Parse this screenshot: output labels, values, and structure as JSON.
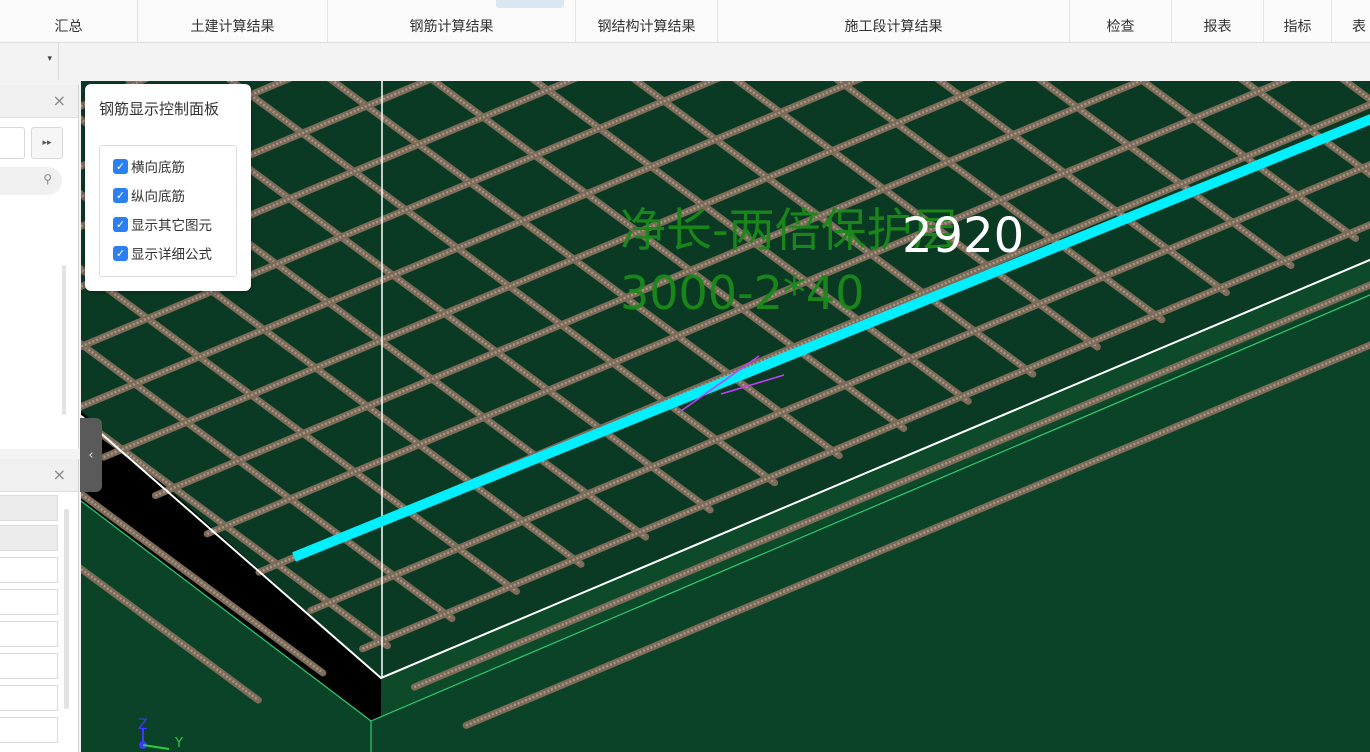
{
  "ribbon": {
    "tabs": [
      {
        "label": "汇总"
      },
      {
        "label": "土建计算结果"
      },
      {
        "label": "钢筋计算结果"
      },
      {
        "label": "钢结构计算结果"
      },
      {
        "label": "施工段计算结果"
      },
      {
        "label": "检查"
      },
      {
        "label": "报表"
      },
      {
        "label": "指标"
      },
      {
        "label": "表"
      }
    ]
  },
  "toolbar": {
    "dropdown_arrow": "▾"
  },
  "left_panel_top": {
    "close_glyph": "×",
    "expand_glyph": "▸▸",
    "search_icon": "search-icon"
  },
  "left_panel_bottom": {
    "close_glyph": "×"
  },
  "collapse_handle": {
    "glyph": "‹"
  },
  "control_panel": {
    "title": "钢筋显示控制面板",
    "options": [
      {
        "label": "横向底筋",
        "checked": true
      },
      {
        "label": "纵向底筋",
        "checked": true
      },
      {
        "label": "显示其它图元",
        "checked": true
      },
      {
        "label": "显示详细公式",
        "checked": true
      }
    ]
  },
  "viewport": {
    "formula_text": "净长-两倍保护层",
    "formula_expr": "3000-2*40",
    "length_value": "2920",
    "axis_z": "Z",
    "axis_y": "Y",
    "colors": {
      "slab": "#0b3a24",
      "rebar": "#7d6b5a",
      "highlight": "#00f0ff",
      "formula": "#1a8a1a",
      "edge": "#ffffff"
    }
  }
}
